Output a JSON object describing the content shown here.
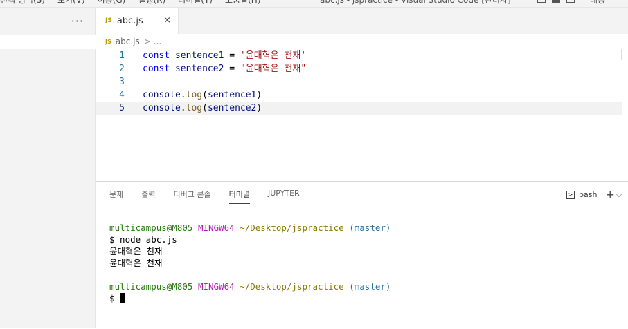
{
  "titlebar": {
    "menus": [
      "선택 영역(S)",
      "보기(V)",
      "이동(G)",
      "실행(R)",
      "터미널(T)",
      "도움말(H)"
    ],
    "window_title": "abc.js - jspractice - Visual Studio Code [관리자]",
    "account": "대응"
  },
  "sidebar": {
    "more": "···"
  },
  "tab": {
    "icon": "JS",
    "name": "abc.js",
    "close": "×"
  },
  "breadcrumb": {
    "icon": "JS",
    "file": "abc.js",
    "sep": ">",
    "dots": "..."
  },
  "editor": {
    "current_line": 5,
    "lines": [
      {
        "num": "1",
        "tokens": [
          {
            "t": "const",
            "c": "kw"
          },
          {
            "t": " ",
            "c": "plain"
          },
          {
            "t": "sentence1",
            "c": "var"
          },
          {
            "t": " = ",
            "c": "plain"
          },
          {
            "t": "'윤대혁은 천재'",
            "c": "str"
          }
        ]
      },
      {
        "num": "2",
        "tokens": [
          {
            "t": "const",
            "c": "kw"
          },
          {
            "t": " ",
            "c": "plain"
          },
          {
            "t": "sentence2",
            "c": "var"
          },
          {
            "t": " = ",
            "c": "plain"
          },
          {
            "t": "\"윤대혁은 천재\"",
            "c": "str"
          }
        ]
      },
      {
        "num": "3",
        "tokens": []
      },
      {
        "num": "4",
        "tokens": [
          {
            "t": "console",
            "c": "var"
          },
          {
            "t": ".",
            "c": "plain"
          },
          {
            "t": "log",
            "c": "fn"
          },
          {
            "t": "(",
            "c": "plain"
          },
          {
            "t": "sentence1",
            "c": "var"
          },
          {
            "t": ")",
            "c": "plain"
          }
        ]
      },
      {
        "num": "5",
        "tokens": [
          {
            "t": "console",
            "c": "var"
          },
          {
            "t": ".",
            "c": "plain"
          },
          {
            "t": "log",
            "c": "fn"
          },
          {
            "t": "(",
            "c": "plain"
          },
          {
            "t": "sentence2",
            "c": "var"
          },
          {
            "t": ")",
            "c": "plain"
          }
        ]
      }
    ]
  },
  "panel": {
    "tabs": [
      "문제",
      "출력",
      "디버그 콘솔",
      "터미널",
      "JUPYTER"
    ],
    "active_tab": "터미널",
    "shell": "bash",
    "plus": "+",
    "chevron": "⌵"
  },
  "terminal": {
    "user": "multicampus@M805",
    "host": "MINGW64",
    "path": "~/Desktop/jspractice",
    "branch": "(master)",
    "command": "$ node abc.js",
    "output": [
      "윤대혁은 천재",
      "윤대혁은 천재"
    ],
    "prompt": "$ "
  },
  "colors": {
    "keyword": "#0000ff",
    "variable": "#001080",
    "string": "#a31515",
    "function": "#795e26",
    "term_user": "#2a7a12",
    "term_host": "#b51fb5",
    "term_path": "#8a7a00",
    "term_branch": "#2c6f9c"
  }
}
